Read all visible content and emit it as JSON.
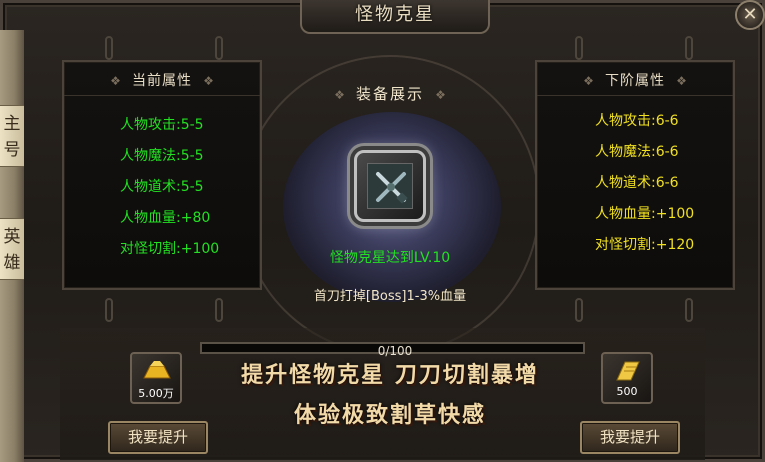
{
  "window": {
    "title": "怪物克星",
    "close_label": "✕"
  },
  "side_tabs": [
    {
      "label": "主\n号"
    },
    {
      "label": "英\n雄"
    }
  ],
  "current_panel": {
    "title": "当前属性",
    "attributes": [
      "人物攻击:5-5",
      "人物魔法:5-5",
      "人物道术:5-5",
      "人物血量:+80",
      "对怪切割:+100"
    ]
  },
  "next_panel": {
    "title": "下阶属性",
    "attributes": [
      "人物攻击:6-6",
      "人物魔法:6-6",
      "人物道术:6-6",
      "人物血量:+100",
      "对怪切割:+120"
    ]
  },
  "equipment": {
    "title": "装备展示",
    "icon": "crossed-swords-icon",
    "unlock_text": "怪物克星达到LV.10",
    "effect_text": "首刀打掉[Boss]1-3%血量"
  },
  "progress": {
    "text": "0/100",
    "fraction": 0.0
  },
  "cost_left": {
    "icon": "gold-ingot-icon",
    "label": "5.00万"
  },
  "cost_right": {
    "icon": "scroll-icon",
    "label": "500"
  },
  "slogan": {
    "line1": "提升怪物克星 刀刀切割暴增",
    "line2": "体验极致割草快感"
  },
  "buttons": {
    "left_label": "我要提升",
    "right_label": "我要提升"
  },
  "colors": {
    "current_attr": "#22e022",
    "next_attr": "#f0e020",
    "progress_fill": "#e04a2a"
  }
}
